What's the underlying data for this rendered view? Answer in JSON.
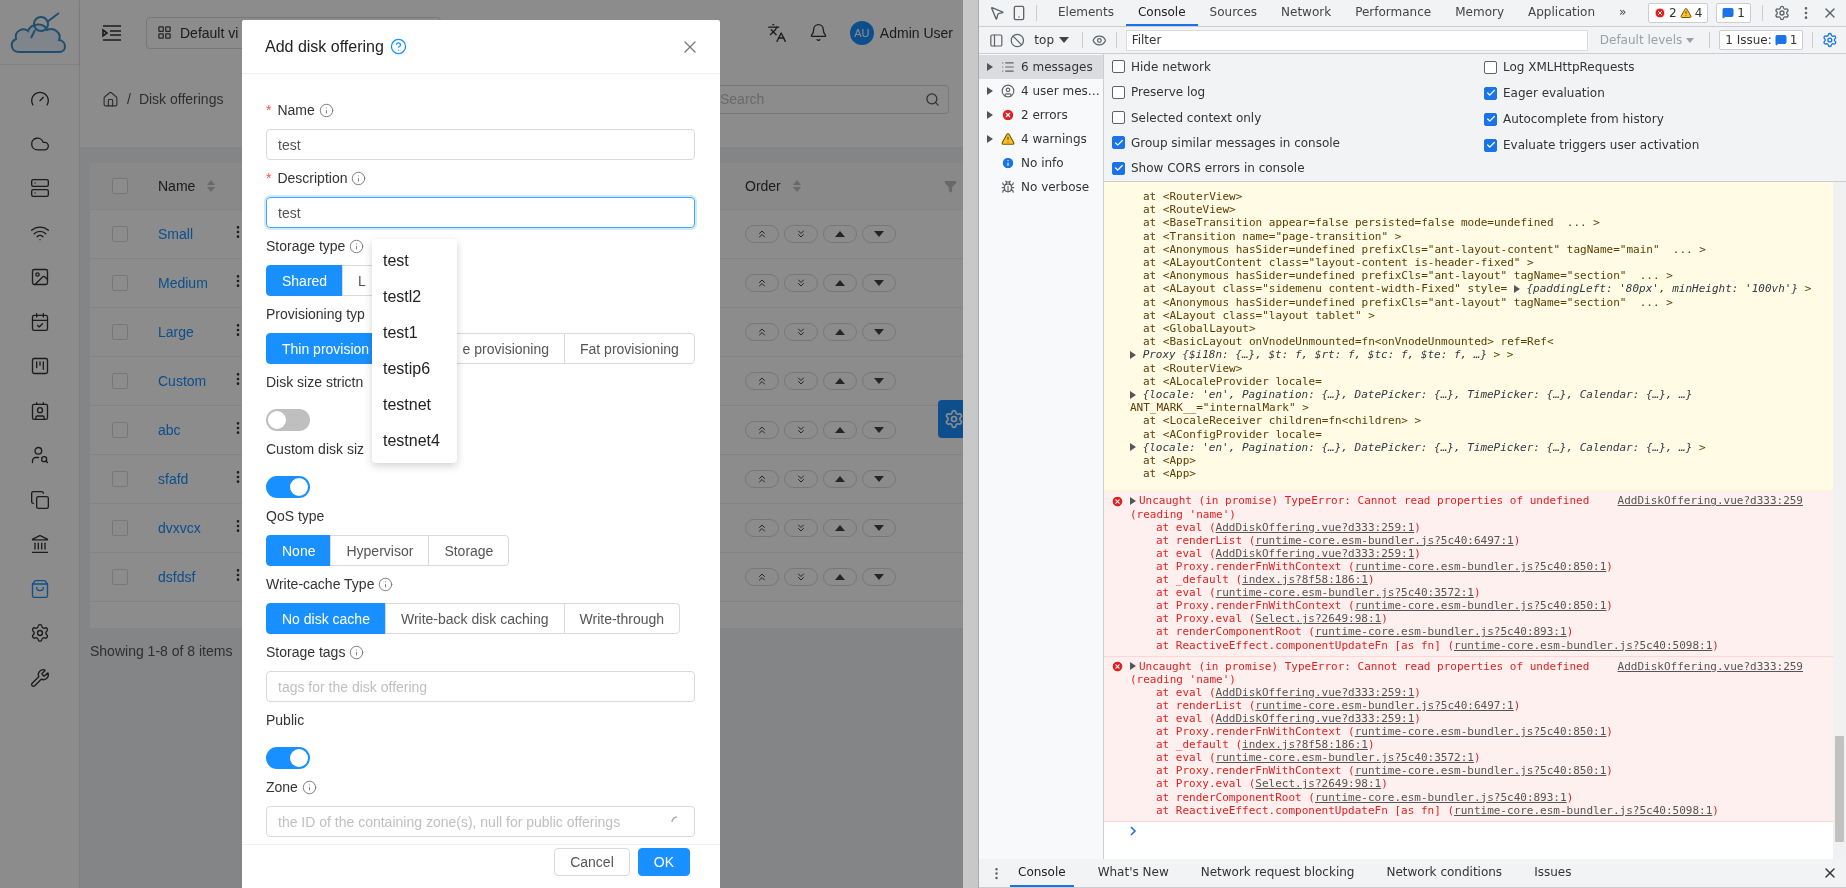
{
  "app": {
    "sidebar": [
      {
        "selected": false
      },
      {
        "selected": false
      },
      {
        "selected": false
      },
      {
        "selected": false
      },
      {
        "selected": false
      },
      {
        "selected": false
      },
      {
        "selected": false
      },
      {
        "selected": false
      },
      {
        "selected": false
      },
      {
        "selected": false
      },
      {
        "selected": false
      },
      {
        "selected": true
      },
      {
        "selected": false
      },
      {
        "selected": false
      }
    ],
    "header": {
      "view": "Default vi",
      "avatar": "AU",
      "user": "Admin User"
    },
    "breadcrumb": {
      "separator": "/",
      "current": "Disk offerings"
    },
    "search": {
      "placeholder": "Search"
    },
    "table": {
      "all_selected": false,
      "columns": [
        {
          "label": "Name"
        },
        {
          "label": "Order"
        }
      ],
      "rows": [
        {
          "name": "Small",
          "selected": false
        },
        {
          "name": "Medium",
          "selected": false
        },
        {
          "name": "Large",
          "selected": false
        },
        {
          "name": "Custom",
          "selected": false
        },
        {
          "name": "abc",
          "selected": false
        },
        {
          "name": "sfafd",
          "selected": false
        },
        {
          "name": "dvxvcx",
          "selected": false
        },
        {
          "name": "dsfdsf",
          "selected": false
        }
      ]
    },
    "pagination": "Showing 1-8 of 8 items"
  },
  "modal": {
    "title": "Add disk offering",
    "fields": [
      {
        "kind": "input",
        "label": "Name",
        "required_mark": "*",
        "info": true,
        "value": "test",
        "focused": false
      },
      {
        "kind": "input",
        "label": "Description",
        "required_mark": "*",
        "info": true,
        "value": "test",
        "focused": true
      },
      {
        "kind": "radio",
        "label": "Storage type",
        "info": true,
        "options": [
          {
            "label": "Shared",
            "selected": true
          },
          {
            "label": "L",
            "selected": false
          }
        ]
      },
      {
        "kind": "radio",
        "label": "Provisioning typ",
        "info": false,
        "options": [
          {
            "label": "Thin provision",
            "selected": true
          },
          {
            "label": "e provisioning",
            "selected": false
          },
          {
            "label": "Fat provisioning",
            "selected": false
          }
        ]
      },
      {
        "kind": "switch",
        "label": "Disk size strictn",
        "info": false,
        "on": false
      },
      {
        "kind": "switch",
        "label": "Custom disk siz",
        "info": false,
        "on": true
      },
      {
        "kind": "radio",
        "label": "QoS type",
        "info": false,
        "options": [
          {
            "label": "None",
            "selected": true
          },
          {
            "label": "Hypervisor",
            "selected": false
          },
          {
            "label": "Storage",
            "selected": false
          }
        ]
      },
      {
        "kind": "radio",
        "label": "Write-cache Type",
        "info": true,
        "options": [
          {
            "label": "No disk cache",
            "selected": true
          },
          {
            "label": "Write-back disk caching",
            "selected": false
          },
          {
            "label": "Write-through",
            "selected": false
          }
        ]
      },
      {
        "kind": "input",
        "label": "Storage tags",
        "info": true,
        "placeholder": "tags for the disk offering",
        "focused": false
      },
      {
        "kind": "switch",
        "label": "Public",
        "info": false,
        "on": true
      },
      {
        "kind": "select",
        "label": "Zone",
        "info": true,
        "placeholder": "the ID of the containing zone(s), null for public offerings",
        "loading": true
      }
    ],
    "buttons": [
      {
        "label": "Cancel",
        "primary": false
      },
      {
        "label": "OK",
        "primary": true
      }
    ]
  },
  "autocomplete": {
    "options": [
      "test",
      "testl2",
      "test1",
      "testip6",
      "testnet",
      "testnet4"
    ]
  },
  "devtools": {
    "tabs": [
      {
        "label": "Elements",
        "selected": false
      },
      {
        "label": "Console",
        "selected": true
      },
      {
        "label": "Sources",
        "selected": false
      },
      {
        "label": "Network",
        "selected": false
      },
      {
        "label": "Performance",
        "selected": false
      },
      {
        "label": "Memory",
        "selected": false
      },
      {
        "label": "Application",
        "selected": false
      }
    ],
    "more": "»",
    "counts": {
      "errors": "2",
      "warnings": "4",
      "messages": "1"
    },
    "context": "top",
    "filter": {
      "placeholder": "Filter"
    },
    "levels": "Default levels",
    "issues": {
      "label": "1 Issue:",
      "count": "1"
    },
    "sidebar": [
      {
        "kind": "messages",
        "label": "6 messages",
        "expandable": true,
        "selected": true
      },
      {
        "kind": "user",
        "label": "4 user mes…",
        "expandable": true,
        "selected": false
      },
      {
        "kind": "error",
        "label": "2 errors",
        "expandable": true,
        "selected": false
      },
      {
        "kind": "warning",
        "label": "4 warnings",
        "expandable": true,
        "selected": false
      },
      {
        "kind": "info",
        "label": "No info",
        "expandable": false,
        "selected": false
      },
      {
        "kind": "verbose",
        "label": "No verbose",
        "expandable": false,
        "selected": false
      }
    ],
    "settings": {
      "left": [
        {
          "label": "Hide network",
          "checked": false
        },
        {
          "label": "Preserve log",
          "checked": false
        },
        {
          "label": "Selected context only",
          "checked": false
        },
        {
          "label": "Group similar messages in console",
          "checked": true
        },
        {
          "label": "Show CORS errors in console",
          "checked": true
        }
      ],
      "right": [
        {
          "label": "Log XMLHttpRequests",
          "checked": false
        },
        {
          "label": "Eager evaluation",
          "checked": true
        },
        {
          "label": "Autocomplete from history",
          "checked": true
        },
        {
          "label": "Evaluate triggers user activation",
          "checked": true
        }
      ]
    },
    "warning": {
      "lines": [
        {
          "kind": "frame",
          "text": "at <RouterView>"
        },
        {
          "kind": "frame",
          "text": "at <RouteView>"
        },
        {
          "kind": "frame",
          "text": "at <BaseTransition appear=false persisted=false mode=undefined  ... >"
        },
        {
          "kind": "frame",
          "text": "at <Transition name=\"page-transition\" >"
        },
        {
          "kind": "frame",
          "text": "at <Anonymous hasSider=undefined prefixCls=\"ant-layout-content\" tagName=\"main\"  ... >"
        },
        {
          "kind": "frame",
          "text": "at <ALayoutContent class=\"layout-content is-header-fixed\" >"
        },
        {
          "kind": "frame",
          "text": "at <Anonymous hasSider=undefined prefixCls=\"ant-layout\" tagName=\"section\"  ... >"
        },
        {
          "kind": "frame",
          "text": "at <ALayout class=\"sidemenu content-width-Fixed\" style= ",
          "object": "{paddingLeft: '80px', minHeight: '100vh'}",
          "tail": " >"
        },
        {
          "kind": "frame",
          "text": "at <Anonymous hasSider=undefined prefixCls=\"ant-layout\" tagName=\"section\"  ... >"
        },
        {
          "kind": "frame",
          "text": "at <ALayout class=\"layout tablet\" >"
        },
        {
          "kind": "frame",
          "text": "at <GlobalLayout>"
        },
        {
          "kind": "frame",
          "text": "at <BasicLayout onVnodeUnmounted=fn<onVnodeUnmounted> ref=Ref<"
        },
        {
          "kind": "cont",
          "object": "Proxy {$i18n: {…}, $t: f, $rt: f, $tc: f, $te: f, …}",
          "tail": " > >"
        },
        {
          "kind": "frame",
          "text": "at <RouterView>"
        },
        {
          "kind": "frame",
          "text": "at <ALocaleProvider locale="
        },
        {
          "kind": "cont",
          "object": "{locale: 'en', Pagination: {…}, DatePicker: {…}, TimePicker: {…}, Calendar: {…}, …}"
        },
        {
          "kind": "cont",
          "text": "ANT_MARK__=\"internalMark\" >"
        },
        {
          "kind": "frame",
          "text": "at <LocaleReceiver children=fn<children> >"
        },
        {
          "kind": "frame",
          "text": "at <AConfigProvider locale="
        },
        {
          "kind": "cont",
          "object": "{locale: 'en', Pagination: {…}, DatePicker: {…}, TimePicker: {…}, Calendar: {…}, …}",
          "tail": " >"
        },
        {
          "kind": "frame",
          "text": "at <App>"
        },
        {
          "kind": "frame",
          "text": "at <App>"
        }
      ]
    },
    "errors": [
      {
        "message": "Uncaught (in promise) TypeError: Cannot read properties of undefined",
        "source": "AddDiskOffering.vue?d333:259",
        "message_cont": "(reading 'name')",
        "frames": [
          {
            "text": "at eval (",
            "link": "AddDiskOffering.vue?d333:259:1",
            "tail": ")"
          },
          {
            "text": "at renderList (",
            "link": "runtime-core.esm-bundler.js?5c40:6497:1",
            "tail": ")"
          },
          {
            "text": "at eval (",
            "link": "AddDiskOffering.vue?d333:259:1",
            "tail": ")"
          },
          {
            "text": "at Proxy.renderFnWithContext (",
            "link": "runtime-core.esm-bundler.js?5c40:850:1",
            "tail": ")"
          },
          {
            "text": "at _default (",
            "link": "index.js?8f58:186:1",
            "tail": ")"
          },
          {
            "text": "at eval (",
            "link": "runtime-core.esm-bundler.js?5c40:3572:1",
            "tail": ")"
          },
          {
            "text": "at Proxy.renderFnWithContext (",
            "link": "runtime-core.esm-bundler.js?5c40:850:1",
            "tail": ")"
          },
          {
            "text": "at Proxy.eval (",
            "link": "Select.js?2649:98:1",
            "tail": ")"
          },
          {
            "text": "at renderComponentRoot (",
            "link": "runtime-core.esm-bundler.js?5c40:893:1",
            "tail": ")"
          },
          {
            "text": "at ReactiveEffect.componentUpdateFn [as fn] (",
            "link": "runtime-core.esm-bundler.js?5c40:5098:1",
            "tail": ")"
          }
        ]
      },
      {
        "message": "Uncaught (in promise) TypeError: Cannot read properties of undefined",
        "source": "AddDiskOffering.vue?d333:259",
        "message_cont": "(reading 'name')",
        "frames": [
          {
            "text": "at eval (",
            "link": "AddDiskOffering.vue?d333:259:1",
            "tail": ")"
          },
          {
            "text": "at renderList (",
            "link": "runtime-core.esm-bundler.js?5c40:6497:1",
            "tail": ")"
          },
          {
            "text": "at eval (",
            "link": "AddDiskOffering.vue?d333:259:1",
            "tail": ")"
          },
          {
            "text": "at Proxy.renderFnWithContext (",
            "link": "runtime-core.esm-bundler.js?5c40:850:1",
            "tail": ")"
          },
          {
            "text": "at _default (",
            "link": "index.js?8f58:186:1",
            "tail": ")"
          },
          {
            "text": "at eval (",
            "link": "runtime-core.esm-bundler.js?5c40:3572:1",
            "tail": ")"
          },
          {
            "text": "at Proxy.renderFnWithContext (",
            "link": "runtime-core.esm-bundler.js?5c40:850:1",
            "tail": ")"
          },
          {
            "text": "at Proxy.eval (",
            "link": "Select.js?2649:98:1",
            "tail": ")"
          },
          {
            "text": "at renderComponentRoot (",
            "link": "runtime-core.esm-bundler.js?5c40:893:1",
            "tail": ")"
          },
          {
            "text": "at ReactiveEffect.componentUpdateFn [as fn] (",
            "link": "runtime-core.esm-bundler.js?5c40:5098:1",
            "tail": ")"
          }
        ]
      }
    ],
    "drawer": {
      "tabs": [
        {
          "label": "Console",
          "selected": true
        },
        {
          "label": "What's New",
          "selected": false
        },
        {
          "label": "Network request blocking",
          "selected": false
        },
        {
          "label": "Network conditions",
          "selected": false
        },
        {
          "label": "Issues",
          "selected": false
        }
      ]
    }
  }
}
